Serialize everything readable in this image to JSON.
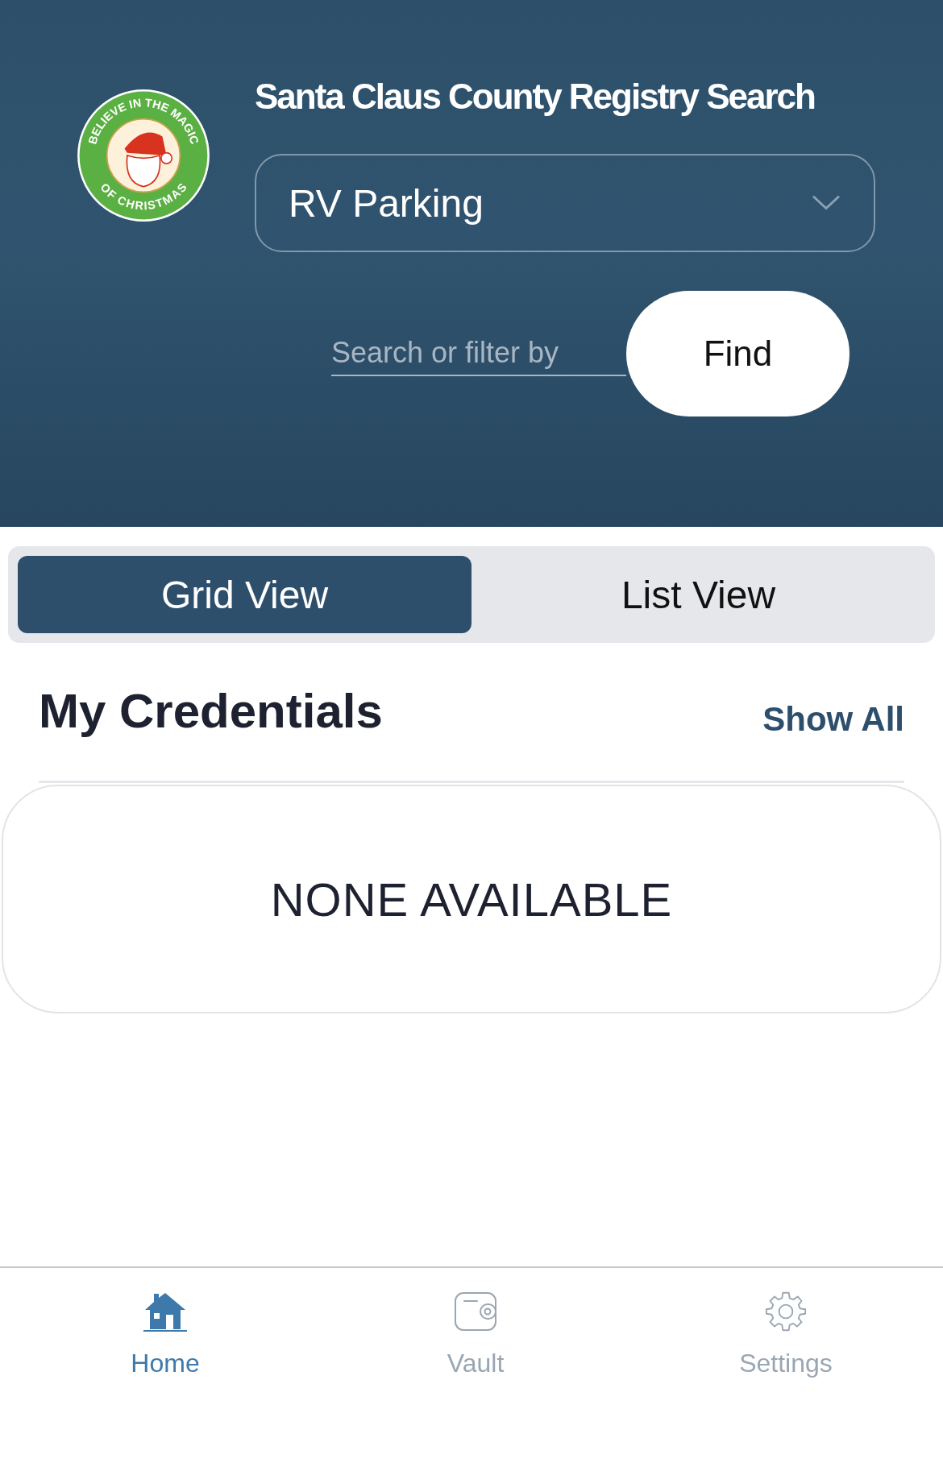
{
  "header": {
    "logo": {
      "top_text": "BELIEVE IN THE MAGIC",
      "bottom_text": "OF CHRISTMAS"
    },
    "title": "Santa Claus County Registry Search",
    "dropdown": {
      "value": "RV Parking"
    },
    "search": {
      "placeholder": "Search or filter by"
    },
    "find_button": "Find"
  },
  "view_tabs": [
    {
      "label": "Grid View",
      "selected": true
    },
    {
      "label": "List View",
      "selected": false
    }
  ],
  "section": {
    "title": "My Credentials",
    "action": "Show All"
  },
  "empty_card": {
    "message": "NONE AVAILABLE"
  },
  "bottom_nav": [
    {
      "label": "Home",
      "kind": "home",
      "selected": true
    },
    {
      "label": "Vault",
      "kind": "wallet",
      "selected": false
    },
    {
      "label": "Settings",
      "kind": "gear",
      "selected": false
    }
  ]
}
